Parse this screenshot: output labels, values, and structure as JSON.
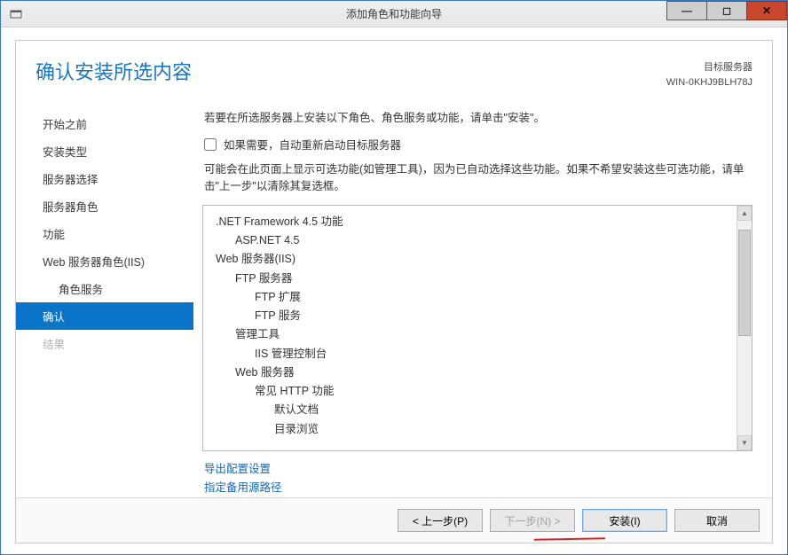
{
  "window": {
    "title": "添加角色和功能向导"
  },
  "header": {
    "title": "确认安装所选内容",
    "target_label": "目标服务器",
    "target_value": "WIN-0KHJ9BLH78J"
  },
  "sidebar": {
    "steps": [
      "开始之前",
      "安装类型",
      "服务器选择",
      "服务器角色",
      "功能",
      "Web 服务器角色(IIS)",
      "角色服务",
      "确认",
      "结果"
    ]
  },
  "content": {
    "intro": "若要在所选服务器上安装以下角色、角色服务或功能，请单击\"安装\"。",
    "checkbox_label": "如果需要，自动重新启动目标服务器",
    "note": "可能会在此页面上显示可选功能(如管理工具)，因为已自动选择这些功能。如果不希望安装这些可选功能，请单击\"上一步\"以清除其复选框。",
    "tree": [
      {
        "t": ".NET Framework 4.5 功能",
        "lv": 0
      },
      {
        "t": "ASP.NET 4.5",
        "lv": 1
      },
      {
        "t": "Web 服务器(IIS)",
        "lv": 0
      },
      {
        "t": "FTP 服务器",
        "lv": 1
      },
      {
        "t": "FTP 扩展",
        "lv": 2
      },
      {
        "t": "FTP 服务",
        "lv": 2
      },
      {
        "t": "管理工具",
        "lv": 1
      },
      {
        "t": "IIS 管理控制台",
        "lv": 2
      },
      {
        "t": "Web 服务器",
        "lv": 1
      },
      {
        "t": "常见 HTTP 功能",
        "lv": 2
      },
      {
        "t": "默认文档",
        "lv": 3
      },
      {
        "t": "目录浏览",
        "lv": 3
      }
    ],
    "links": {
      "export": "导出配置设置",
      "alt_source": "指定备用源路径"
    }
  },
  "footer": {
    "prev": "< 上一步(P)",
    "next": "下一步(N) >",
    "install": "安装(I)",
    "cancel": "取消"
  }
}
